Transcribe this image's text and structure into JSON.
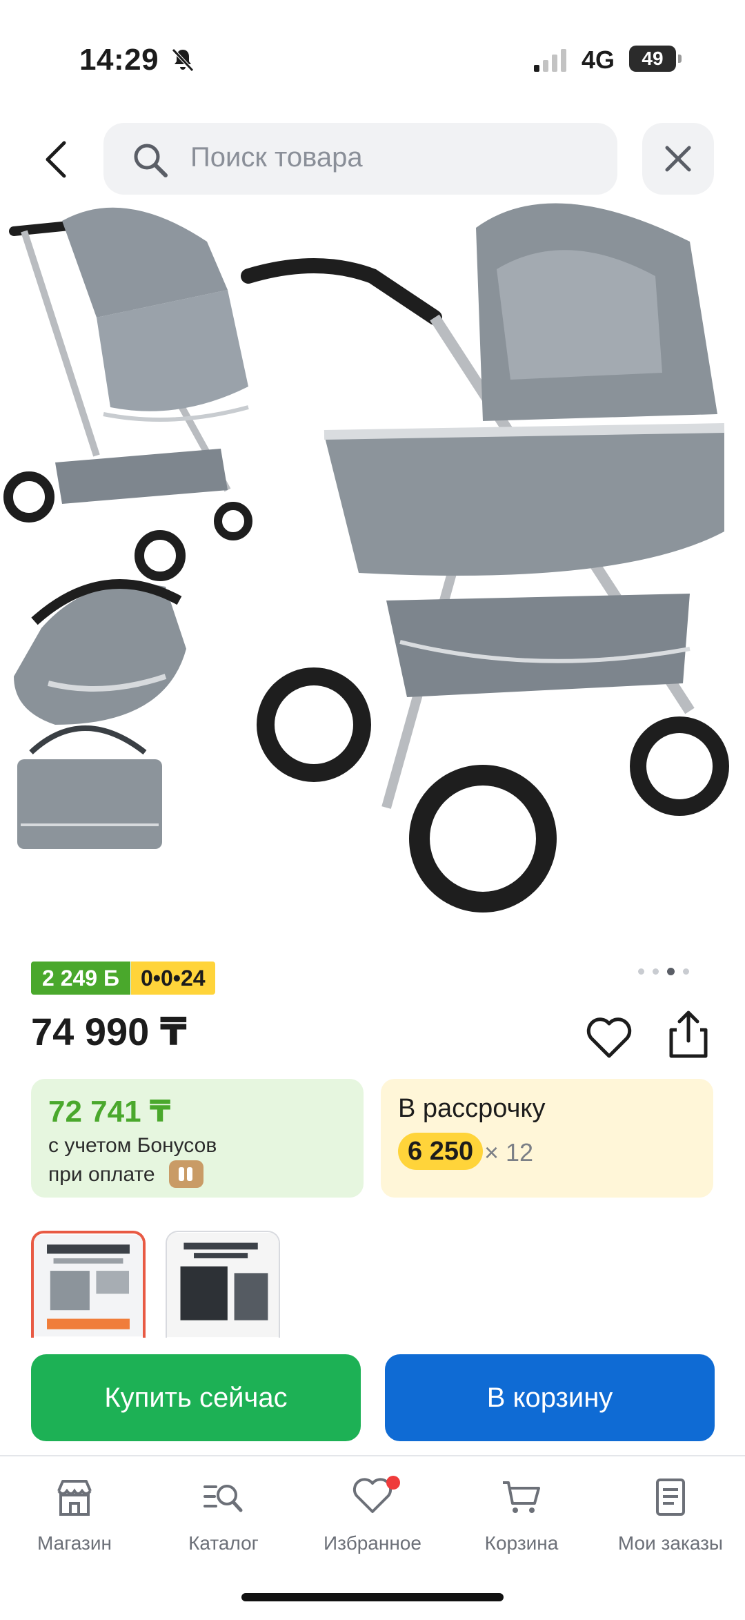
{
  "status_bar": {
    "time": "14:29",
    "network": "4G",
    "battery": "49"
  },
  "search": {
    "placeholder": "Поиск товара"
  },
  "badges": {
    "bonus": "2 249 Б",
    "installment": "0•0•24"
  },
  "gallery": {
    "dot_count": 4,
    "active_dot": 3
  },
  "product": {
    "price": "74 990 ₸"
  },
  "bonus_card": {
    "price": "72 741 ₸",
    "line1": "с учетом Бонусов",
    "line2": "при оплате"
  },
  "installment_card": {
    "title": "В рассрочку",
    "amount": "6 250",
    "times": "× 12"
  },
  "actions": {
    "buy_now": "Купить сейчас",
    "add_to_cart": "В корзину"
  },
  "bottom_nav": {
    "items": [
      {
        "label": "Магазин",
        "icon": "shop-icon"
      },
      {
        "label": "Каталог",
        "icon": "catalog-icon"
      },
      {
        "label": "Избранное",
        "icon": "heart-icon"
      },
      {
        "label": "Корзина",
        "icon": "cart-icon"
      },
      {
        "label": "Мои заказы",
        "icon": "orders-icon"
      }
    ]
  },
  "colors": {
    "bonus_green": "#4aa82c",
    "installment_yellow": "#ffd43a",
    "buy_green": "#1db155",
    "cart_blue": "#0f6bd4",
    "notification_red": "#ef3b3b"
  }
}
